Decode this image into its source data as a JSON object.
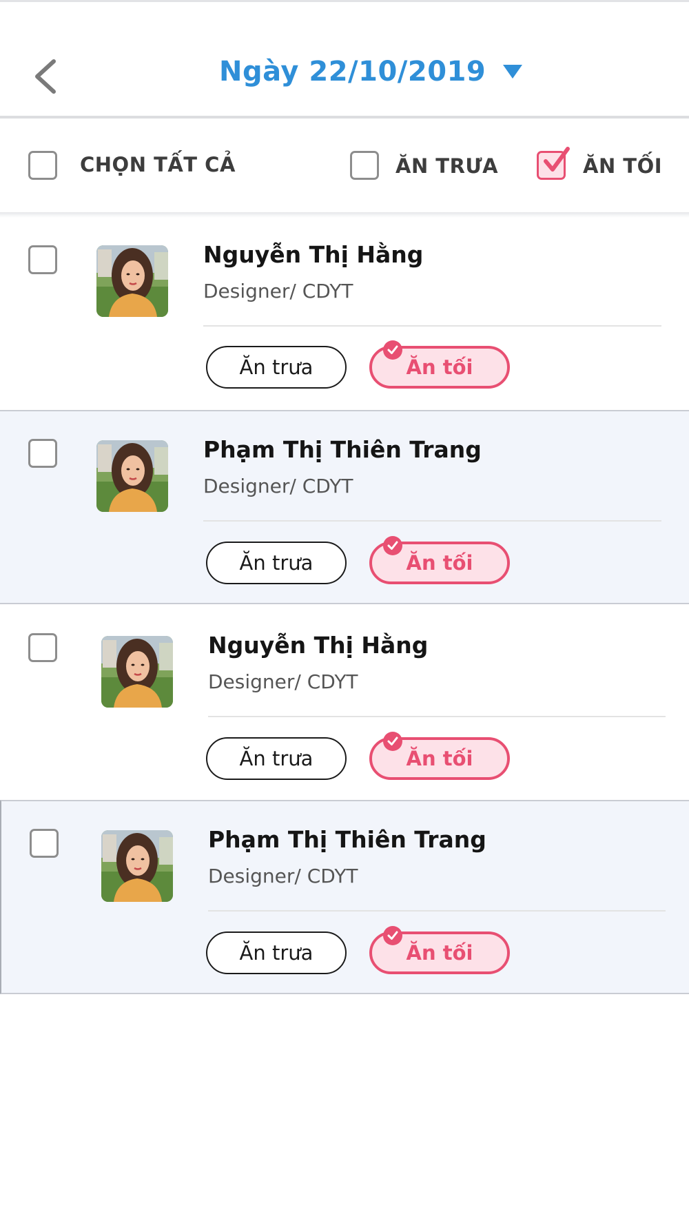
{
  "header": {
    "title": "Ngày 22/10/2019"
  },
  "filters": {
    "select_all": {
      "label": "CHỌN TẤT CẢ",
      "checked": false
    },
    "lunch": {
      "label": "ĂN TRƯA",
      "checked": false
    },
    "dinner": {
      "label": "ĂN TỐI",
      "checked": true
    }
  },
  "colors": {
    "accent_blue": "#2f8fd8",
    "accent_pink": "#e84f72",
    "pink_fill": "#fde1e8",
    "row_shade": "#f2f5fb"
  },
  "items": [
    {
      "name": "Nguyễn Thị Hằng",
      "role": "Designer/ CDYT",
      "checked": false,
      "lunch_label": "Ăn trưa",
      "dinner_label": "Ăn tối",
      "lunch_selected": false,
      "dinner_selected": true
    },
    {
      "name": "Phạm Thị Thiên Trang",
      "role": "Designer/ CDYT",
      "checked": false,
      "lunch_label": "Ăn trưa",
      "dinner_label": "Ăn tối",
      "lunch_selected": false,
      "dinner_selected": true
    },
    {
      "name": "Nguyễn Thị Hằng",
      "role": "Designer/ CDYT",
      "checked": false,
      "lunch_label": "Ăn trưa",
      "dinner_label": "Ăn tối",
      "lunch_selected": false,
      "dinner_selected": true
    },
    {
      "name": "Phạm Thị Thiên Trang",
      "role": "Designer/ CDYT",
      "checked": false,
      "lunch_label": "Ăn trưa",
      "dinner_label": "Ăn tối",
      "lunch_selected": false,
      "dinner_selected": true
    }
  ]
}
